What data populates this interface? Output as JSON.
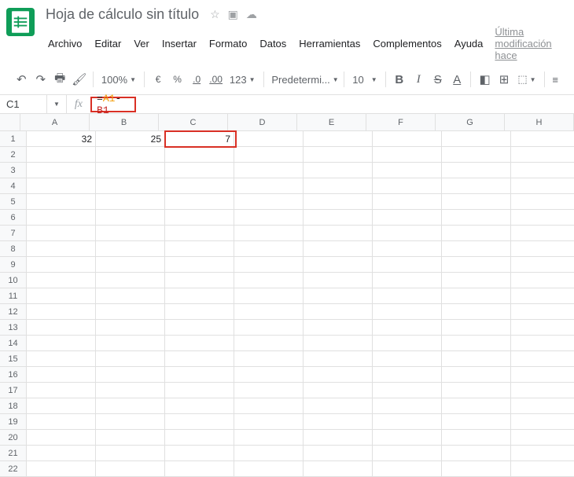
{
  "header": {
    "doc_title": "Hoja de cálculo sin título",
    "last_modification": "Última modificación hace"
  },
  "menus": {
    "archivo": "Archivo",
    "editar": "Editar",
    "ver": "Ver",
    "insertar": "Insertar",
    "formato": "Formato",
    "datos": "Datos",
    "herramientas": "Herramientas",
    "complementos": "Complementos",
    "ayuda": "Ayuda"
  },
  "toolbar": {
    "zoom": "100%",
    "currency": "€",
    "percent": "%",
    "dec_dec": ".0",
    "inc_dec": ".00",
    "more_formats": "123",
    "font": "Predetermi...",
    "font_size": "10"
  },
  "formula_bar": {
    "name_box": "C1",
    "fx_label": "fx",
    "formula_eq": "=",
    "formula_ref1": "A1",
    "formula_op": "-",
    "formula_ref2": "B1"
  },
  "grid": {
    "columns": [
      "A",
      "B",
      "C",
      "D",
      "E",
      "F",
      "G",
      "H"
    ],
    "rows": [
      "1",
      "2",
      "3",
      "4",
      "5",
      "6",
      "7",
      "8",
      "9",
      "10",
      "11",
      "12",
      "13",
      "14",
      "15",
      "16",
      "17",
      "18",
      "19",
      "20",
      "21",
      "22"
    ],
    "cells": {
      "A1": "32",
      "B1": "25",
      "C1": "7"
    },
    "selected_cell": "C1"
  }
}
